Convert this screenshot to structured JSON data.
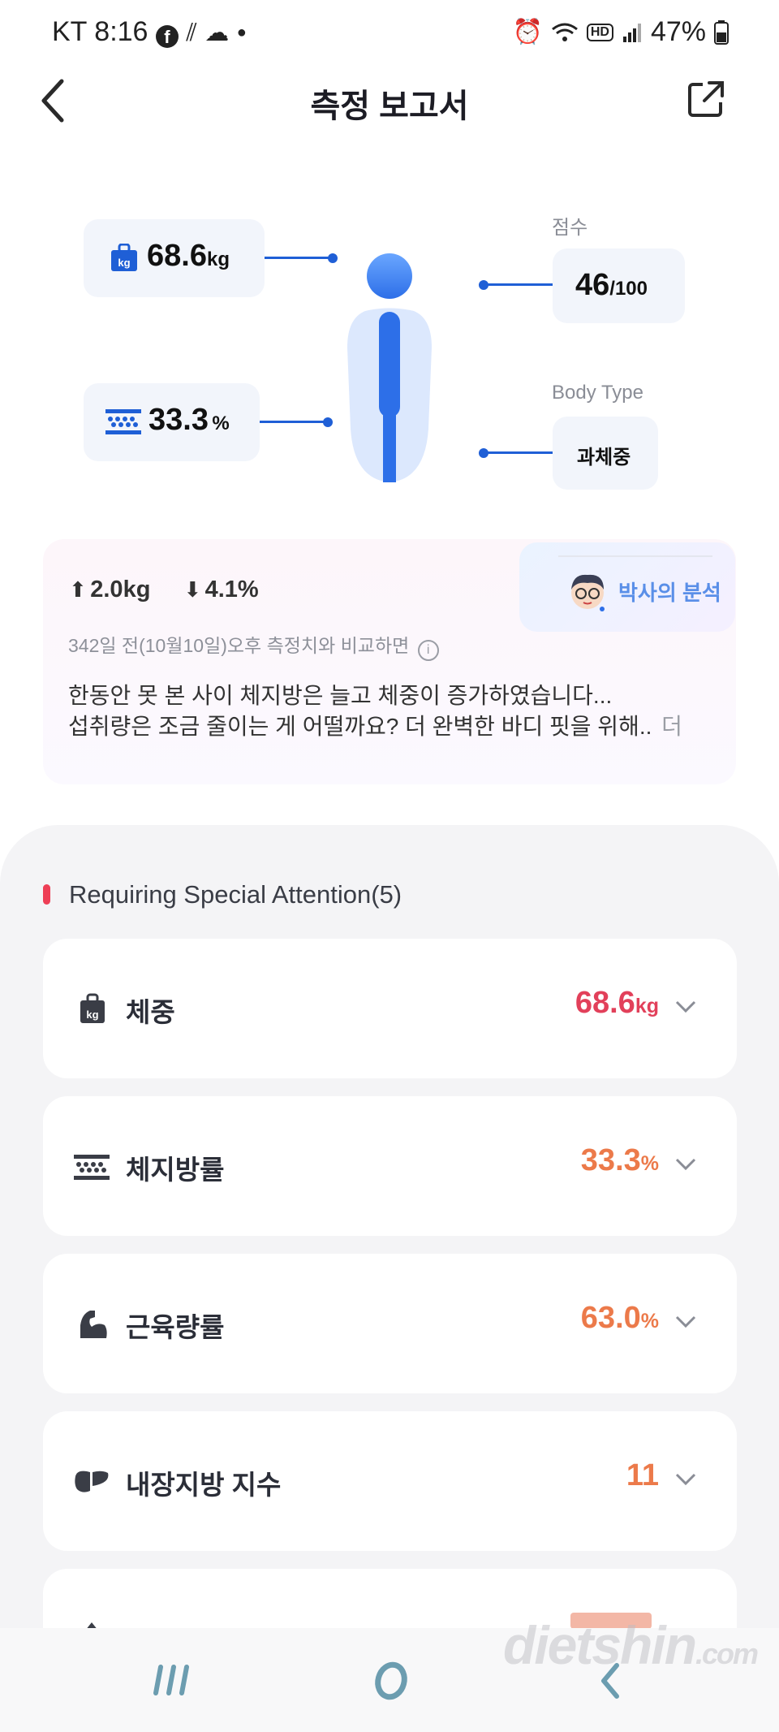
{
  "status_bar": {
    "carrier": "KT",
    "time": "8:16",
    "battery": "47%"
  },
  "header": {
    "title": "측정 보고서"
  },
  "figure": {
    "weight_value": "68.6",
    "weight_unit": "kg",
    "fat_value": "33.3",
    "fat_unit": "%",
    "score_label": "점수",
    "score_value": "46",
    "score_max": "/100",
    "body_type_label": "Body Type",
    "body_type_value": "과체중"
  },
  "analysis": {
    "badge": "박사의 분석",
    "weight_change": "2.0kg",
    "fat_change": "4.1%",
    "comparison_note": "342일 전(10월10일)오후 측정치와 비교하면",
    "line1": "한동안 못 본 사이 체지방은 늘고 체중이 증가하였습니다...",
    "line2": "섭취량은 조금 줄이는 게 어떨까요? 더 완벽한 바디 핏을 위해..",
    "more": "더"
  },
  "attention": {
    "title": "Requiring Special Attention(5)",
    "items": [
      {
        "name": "체중",
        "value": "68.6",
        "unit": "kg",
        "color": "#e2405a",
        "icon": "weight-icon"
      },
      {
        "name": "체지방률",
        "value": "33.3",
        "unit": "%",
        "color": "#ec7a4a",
        "icon": "body-fat-icon"
      },
      {
        "name": "근육량률",
        "value": "63.0",
        "unit": "%",
        "color": "#ec7a4a",
        "icon": "muscle-icon"
      },
      {
        "name": "내장지방 지수",
        "value": "11",
        "unit": "",
        "color": "#ec7a4a",
        "icon": "liver-icon"
      }
    ]
  },
  "watermark": {
    "brand": "dietshin",
    "domain": ".com"
  },
  "colors": {
    "accent": "#1f5fd6",
    "warning_red": "#e2405a",
    "warning_orange": "#ec7a4a"
  }
}
